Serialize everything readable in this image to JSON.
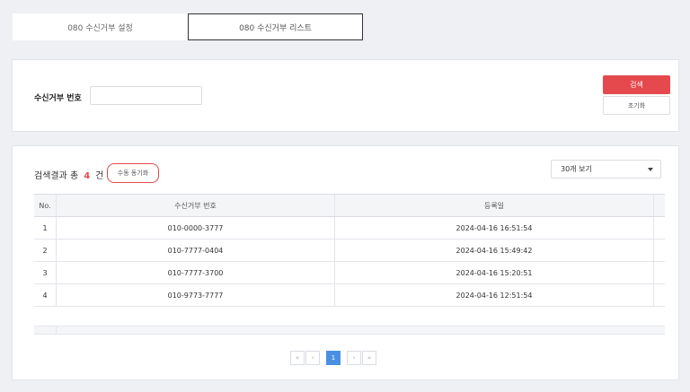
{
  "tabs": [
    "080 수신거부 설정",
    "080 수신거부 리스트"
  ],
  "search": {
    "label": "수신거부 번호",
    "value": "",
    "placeholder": "",
    "search_button": "검색",
    "reset_button": "초기화"
  },
  "result": {
    "prefix": "검색결과 총",
    "count": "4",
    "suffix": "건",
    "sync_button": "수동 동기화",
    "per_page": "30개 보기"
  },
  "table": {
    "columns": [
      "No.",
      "수신거부 번호",
      "등록일"
    ],
    "rows": [
      {
        "no": "1",
        "number": "010-0000-3777",
        "date": "2024-04-16 16:51:54"
      },
      {
        "no": "2",
        "number": "010-7777-0404",
        "date": "2024-04-16 15:49:42"
      },
      {
        "no": "3",
        "number": "010-7777-3700",
        "date": "2024-04-16 15:20:51"
      },
      {
        "no": "4",
        "number": "010-9773-7777",
        "date": "2024-04-16 12:51:54"
      }
    ]
  },
  "pagination": {
    "first": "«",
    "prev": "‹",
    "current": "1",
    "next": "›",
    "last": "»"
  },
  "colors": {
    "accent": "#e5494e",
    "page_active": "#4a90e2",
    "background": "#eef0f4"
  }
}
